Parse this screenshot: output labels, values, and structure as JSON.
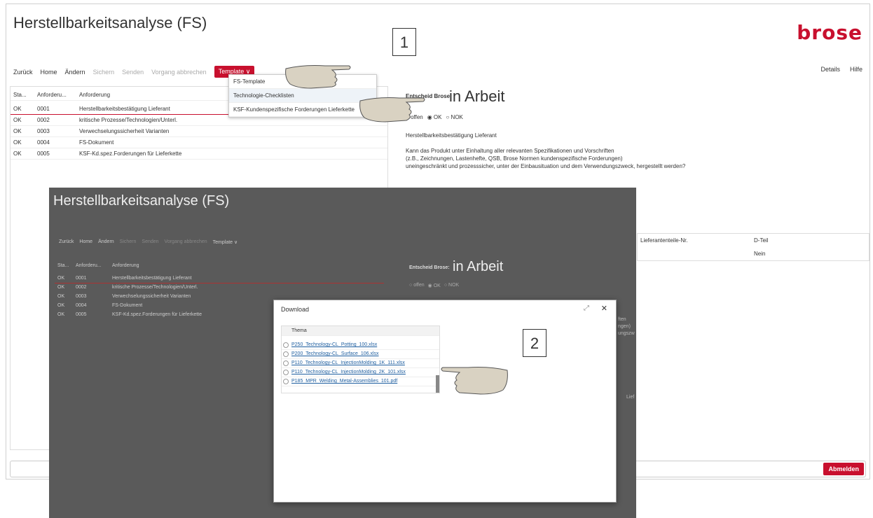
{
  "app": {
    "title": "Herstellbarkeitsanalyse (FS)",
    "brand": "brose",
    "toolbar": {
      "zurueck": "Zurück",
      "home": "Home",
      "aendern": "Ändern",
      "sichern": "Sichern",
      "senden": "Senden",
      "abbrechen": "Vorgang abbrechen",
      "template": "Template ∨",
      "details": "Details",
      "hilfe": "Hilfe"
    },
    "table": {
      "headers": [
        "Sta...",
        "Anforderu...",
        "Anforderung"
      ],
      "rows": [
        {
          "status": "OK",
          "nr": "0001",
          "text": "Herstellbarkeitsbestätigung Lieferant"
        },
        {
          "status": "OK",
          "nr": "0002",
          "text": "kritische Prozesse/Technologien/Unterl."
        },
        {
          "status": "OK",
          "nr": "0003",
          "text": "Verwechselungssicherheit Varianten"
        },
        {
          "status": "OK",
          "nr": "0004",
          "text": "FS-Dokument"
        },
        {
          "status": "OK",
          "nr": "0005",
          "text": "KSF-Kd.spez.Forderungen für Lieferkette"
        }
      ]
    },
    "menu": {
      "items": [
        "FS-Template",
        "Technologie-Checklisten",
        "KSF-Kundenspezifische Forderungen Lieferkette"
      ]
    },
    "detail": {
      "entscheid_label": "Entscheid Brose:",
      "status": "in Arbeit",
      "radio_offen": "offen",
      "radio_ok": "OK",
      "radio_nok": "NOK",
      "heading": "Herstellbarkeitsbestätigung Lieferant",
      "text1": "Kann das Produkt unter Einhaltung aller relevanten Spezifikationen und Vorschriften",
      "text2": "(z.B., Zeichnungen, Lastenhefte, QSB, Brose Normen kundenspezifische Forderungen)",
      "text3": "uneingeschränkt und prozesssicher, unter der Einbausituation und dem Verwendungszweck, hergestellt werden?",
      "col_lief": "Lieferantenteile-Nr.",
      "col_dteil": "D-Teil",
      "val_dteil": "Nein"
    },
    "logout": "Abmelden"
  },
  "callouts": {
    "one": "1",
    "two": "2"
  },
  "dialog": {
    "title": "Download",
    "column": "Thema",
    "files": [
      "P250_Technology-CL_Potting_100.xlsx",
      "P200_Technology-CL_Surface_106.xlsx",
      "P110_Technology-CL_InjectionMolding_1K_111.xlsx",
      "P110_Technology-CL_InjectionMolding_2K_101.xlsx",
      "P185_MPR_Welding_Metal-Assemblies_101.pdf"
    ]
  },
  "shot2": {
    "title": "Herstellbarkeitsanalyse (FS)",
    "partial_right": [
      "ften",
      "ngen)",
      "ungszw"
    ],
    "lief": "Lief"
  }
}
